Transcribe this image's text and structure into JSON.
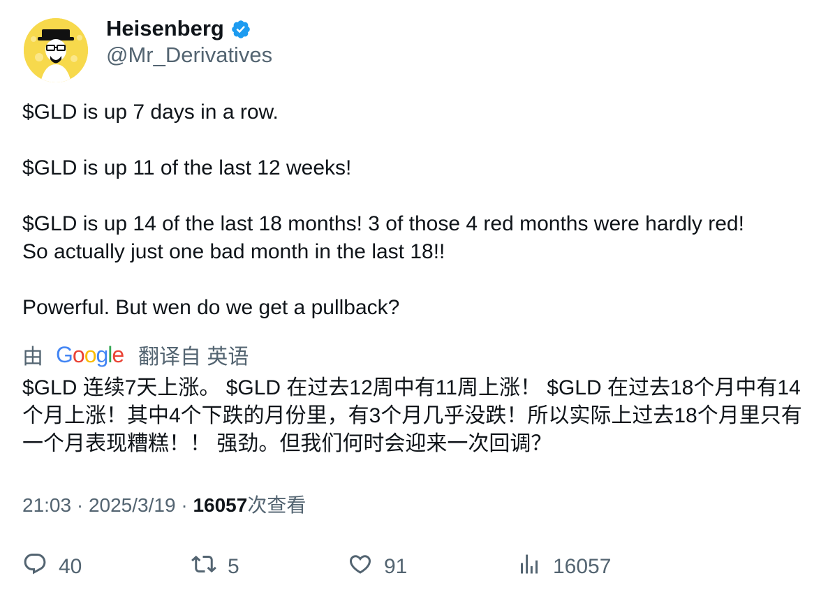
{
  "author": {
    "display_name": "Heisenberg",
    "handle": "@Mr_Derivatives",
    "verified": true,
    "avatar_icon": "heisenberg-avatar-icon"
  },
  "tweet": {
    "paragraphs": [
      "$GLD is up 7 days in a row.",
      "$GLD is up 11 of the last 12 weeks!",
      "$GLD is up 14 of the last 18 months! 3 of those 4 red months were hardly red!\nSo actually just one bad month in the last 18!!",
      "Powerful. But wen do we get a pullback?"
    ]
  },
  "translation": {
    "by_label": "由",
    "provider": "Google",
    "from_label": "翻译自 英语",
    "text": "$GLD 连续7天上涨。 $GLD 在过去12周中有11周上涨！ $GLD 在过去18个月中有14个月上涨！其中4个下跌的月份里，有3个月几乎没跌！所以实际上过去18个月里只有一个月表现糟糕！！ 强劲。但我们何时会迎来一次回调？"
  },
  "meta": {
    "time": "21:03",
    "separator": " · ",
    "date": "2025/3/19",
    "views": "16057",
    "views_label": "次查看"
  },
  "actions": {
    "replies": "40",
    "retweets": "5",
    "likes": "91",
    "views": "16057"
  },
  "colors": {
    "text_primary": "#0f1419",
    "text_secondary": "#536471",
    "verified_blue": "#1d9bf0",
    "google_blue": "#4285f4",
    "google_red": "#ea4335",
    "google_yellow": "#fbbc05",
    "google_green": "#34a853"
  }
}
